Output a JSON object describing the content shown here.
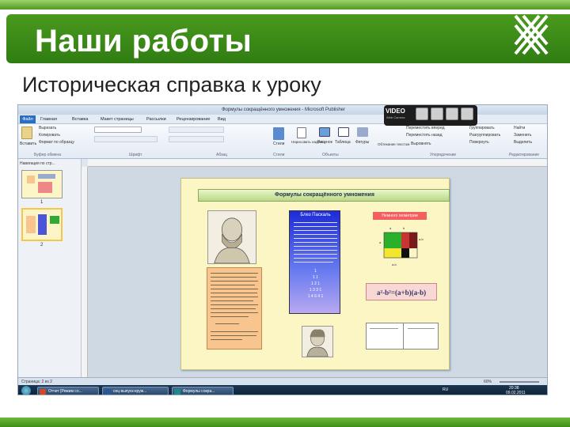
{
  "slide": {
    "title": "Наши работы",
    "subtitle": "Историческая справка к уроку"
  },
  "publisher": {
    "window_title": "Формулы сокращённого умножения - Microsoft Publisher",
    "file_tab": "Файл",
    "tabs": [
      "Главная",
      "Вставка",
      "Макет страницы",
      "Рассылки",
      "Рецензирование",
      "Вид"
    ],
    "clipboard": {
      "paste": "Вставить",
      "cut": "Вырезать",
      "copy": "Копировать",
      "format_painter": "Формат по образцу"
    },
    "ribbon_items": {
      "styles": "Стили",
      "draw_label": "Нарисовать надпись",
      "picture": "Рисунок",
      "table": "Таблица",
      "shapes": "Фигуры",
      "bring_forward": "Переместить вперед",
      "send_backward": "Переместить назад",
      "align": "Выровнять",
      "group": "Группировать",
      "ungroup": "Разгруппировать",
      "rotate": "Повернуть",
      "find": "Найти",
      "replace": "Заменить",
      "select": "Выделить",
      "wrap_text": "Обтекание текстом"
    },
    "groups": {
      "clipboard": "Буфер обмена",
      "font": "Шрифт",
      "paragraph": "Абзац",
      "styles": "Стили",
      "objects": "Объекты",
      "arrange": "Упорядочение",
      "editing": "Редактирование"
    },
    "nav_title": "Навигация по стр...",
    "page_numbers": [
      "1",
      "2"
    ],
    "video_label": "VIDEO",
    "video_sub": "Web Camera",
    "document": {
      "header": "Формулы сокращённого умножения",
      "blue_panel_title": "Блез Паскаль",
      "red_label": "Немного геометрии",
      "formula": "a²-b²=(a+b)(a-b)",
      "pascal_triangle": [
        "1",
        "1 1",
        "1 2 1",
        "1 3 3 1",
        "1 4 6 4 1"
      ],
      "square_labels": [
        "a",
        "b",
        "a-b",
        "a",
        "a-b"
      ]
    },
    "status": {
      "page": "Страница: 2 из 2",
      "zoom": "60%"
    },
    "taskbar": {
      "items": [
        "Отчет [Режим со...",
        "сец выпуск-круж...",
        "Формулы сокра..."
      ],
      "lang": "RU",
      "time": "20:38",
      "date": "09.02.2011"
    }
  },
  "colors": {
    "title_green": "#3a8a18",
    "accent_green": "#6fb83a",
    "page_yellow": "#fbf6c4",
    "blue_panel": "#1c2cd8",
    "orange_box": "#f8c58f",
    "red_label": "#f26060"
  }
}
